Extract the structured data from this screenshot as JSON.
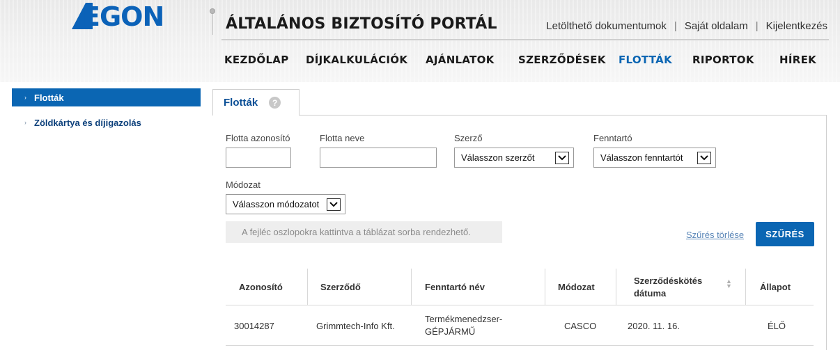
{
  "brand": {
    "logo_text": "EGON",
    "accent": "#0b66b3"
  },
  "header": {
    "title": "ÁLTALÁNOS BIZTOSÍTÓ PORTÁL",
    "links": [
      "Letölthető dokumentumok",
      "Saját oldalam",
      "Kijelentkezés"
    ],
    "separator": "|"
  },
  "nav": {
    "items": [
      "KEZDŐLAP",
      "DÍJKALKULÁCIÓK",
      "AJÁNLATOK",
      "SZERZŐDÉSEK",
      "FLOTTÁK",
      "RIPORTOK",
      "HÍREK"
    ],
    "active": "FLOTTÁK"
  },
  "sidebar": {
    "items": [
      {
        "label": "Flották",
        "active": true
      },
      {
        "label": "Zöldkártya és díjigazolás",
        "active": false
      }
    ]
  },
  "tab": {
    "label": "Flották",
    "help_icon": "question-icon",
    "help_glyph": "?"
  },
  "filters": {
    "fleet_id_label": "Flotta azonosító",
    "fleet_id_value": "",
    "fleet_name_label": "Flotta neve",
    "fleet_name_value": "",
    "contractor_label": "Szerző",
    "contractor_value": "Válasszon szerzőt",
    "holder_label": "Fenntartó",
    "holder_value": "Válasszon fenntartót",
    "mode_label": "Módozat",
    "mode_value": "Válasszon módozatot",
    "hint": "A fejléc oszlopokra kattintva a táblázat sorba rendezhető.",
    "clear_label": "Szűrés törlése",
    "filter_label": "SZŰRÉS"
  },
  "table": {
    "columns": [
      "Azonosító",
      "Szerződő",
      "Fenntartó név",
      "Módozat",
      "Szerződéskötés dátuma",
      "Állapot"
    ],
    "rows": [
      [
        "30014287",
        "Grimmtech-Info Kft.",
        "Termékmenedzser-GÉPJÁRMŰ",
        "CASCO",
        "2020. 11. 16.",
        "ÉLŐ"
      ]
    ]
  }
}
